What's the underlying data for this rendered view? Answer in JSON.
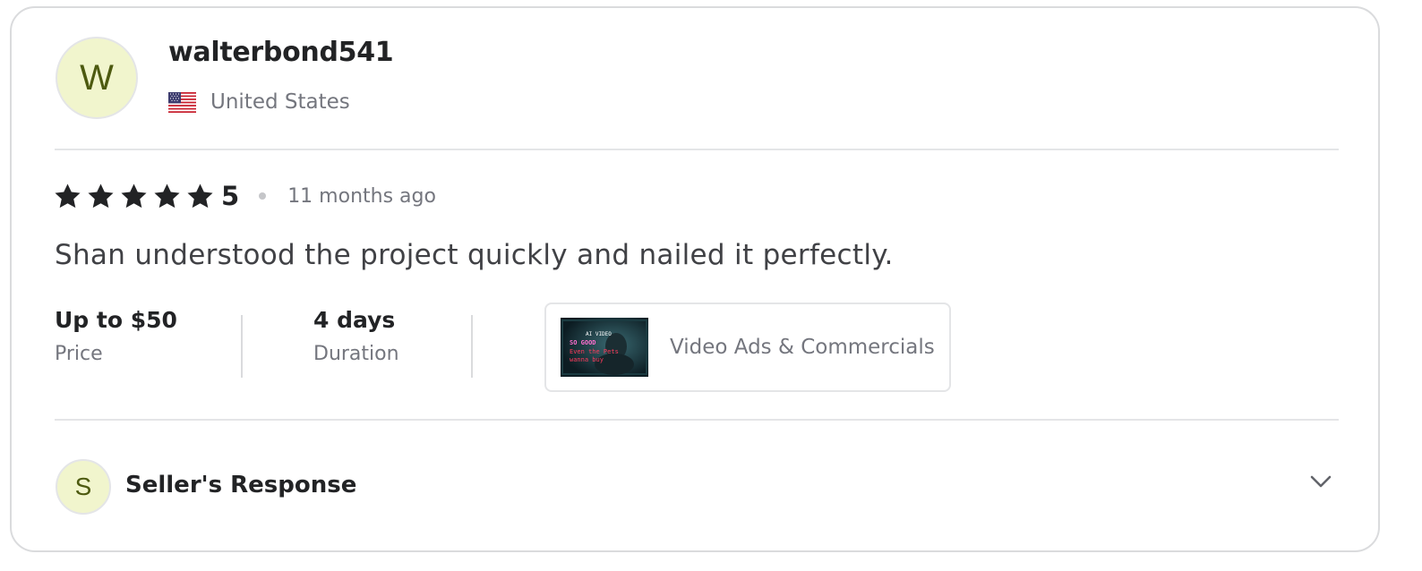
{
  "reviewer": {
    "avatar_initial": "W",
    "username": "walterbond541",
    "country": "United States"
  },
  "review": {
    "rating": "5",
    "stars_count": 5,
    "time_ago": "11 months ago",
    "text": "Shan understood the project quickly and nailed it perfectly."
  },
  "meta": {
    "price_value": "Up to $50",
    "price_label": "Price",
    "duration_value": "4 days",
    "duration_label": "Duration"
  },
  "gig": {
    "title": "Video Ads & Commercials",
    "thumb_text": [
      "AI VIDEO",
      "SO GOOD",
      "Even the Pets",
      "wanna buy"
    ]
  },
  "seller_response": {
    "avatar_initial": "S",
    "label": "Seller's Response"
  },
  "colors": {
    "avatar_bg": "#f1f5cd",
    "avatar_text": "#4d5a10",
    "text_primary": "#222325",
    "text_muted": "#74767e",
    "border": "#dadbdd"
  },
  "icons": {
    "star": "star-icon",
    "flag": "us-flag-icon",
    "chevron": "chevron-down-icon"
  }
}
